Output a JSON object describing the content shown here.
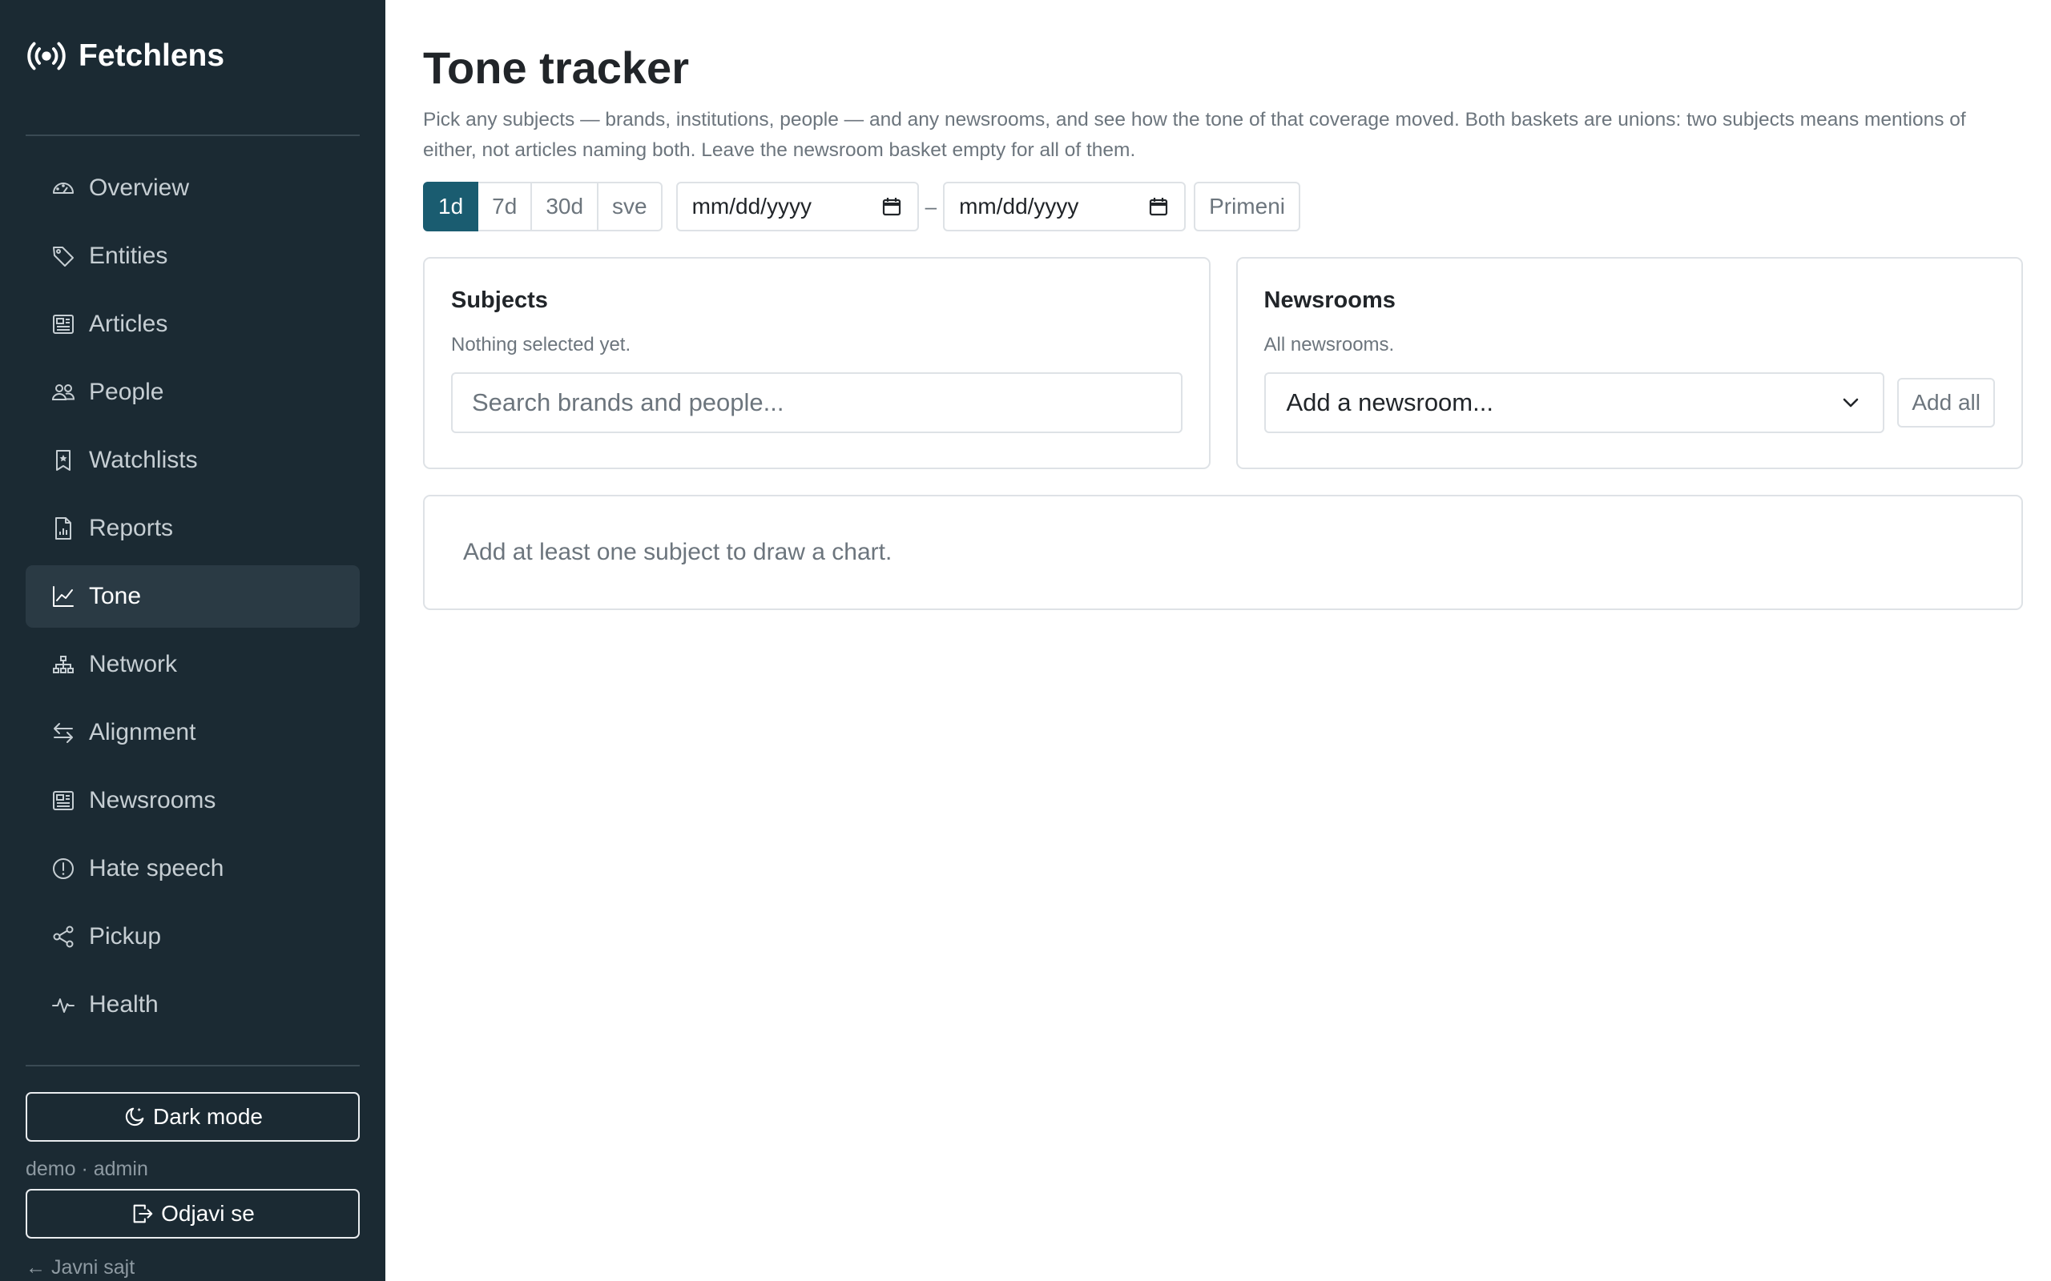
{
  "brand": {
    "name": "Fetchlens",
    "icon": "broadcast-icon"
  },
  "sidebar": {
    "items": [
      {
        "label": "Overview",
        "icon": "speedometer-icon",
        "active": false
      },
      {
        "label": "Entities",
        "icon": "tags-icon",
        "active": false
      },
      {
        "label": "Articles",
        "icon": "newspaper-icon",
        "active": false
      },
      {
        "label": "People",
        "icon": "people-icon",
        "active": false
      },
      {
        "label": "Watchlists",
        "icon": "bookmark-star-icon",
        "active": false
      },
      {
        "label": "Reports",
        "icon": "file-chart-icon",
        "active": false
      },
      {
        "label": "Tone",
        "icon": "graph-up-icon",
        "active": true
      },
      {
        "label": "Network",
        "icon": "diagram-icon",
        "active": false
      },
      {
        "label": "Alignment",
        "icon": "arrows-exchange-icon",
        "active": false
      },
      {
        "label": "Newsrooms",
        "icon": "newspaper-icon",
        "active": false
      },
      {
        "label": "Hate speech",
        "icon": "exclamation-circle-icon",
        "active": false
      },
      {
        "label": "Pickup",
        "icon": "share-icon",
        "active": false
      },
      {
        "label": "Health",
        "icon": "activity-icon",
        "active": false
      }
    ],
    "dark_mode_label": "Dark mode",
    "user_line": "demo · admin",
    "logout_label": "Odjavi se",
    "public_site_label": "← Javni sajt"
  },
  "main": {
    "title": "Tone tracker",
    "lead": "Pick any subjects — brands, institutions, people — and any newsrooms, and see how the tone of that coverage moved. Both baskets are unions: two subjects means mentions of either, not articles naming both. Leave the newsroom basket empty for all of them.",
    "ranges": [
      "1d",
      "7d",
      "30d",
      "sve"
    ],
    "active_range": "1d",
    "date_from_placeholder": "mm/dd/yyyy",
    "date_to_placeholder": "mm/dd/yyyy",
    "date_separator": "–",
    "apply_label": "Primeni",
    "subjects": {
      "title": "Subjects",
      "status": "Nothing selected yet.",
      "search_placeholder": "Search brands and people..."
    },
    "newsrooms": {
      "title": "Newsrooms",
      "status": "All newsrooms.",
      "select_value": "Add a newsroom...",
      "add_all_label": "Add all"
    },
    "empty_chart_message": "Add at least one subject to draw a chart."
  },
  "colors": {
    "sidebar_bg": "#1b2a33",
    "accent": "#1a5c70",
    "active_item_bg": "#2a3a44"
  }
}
